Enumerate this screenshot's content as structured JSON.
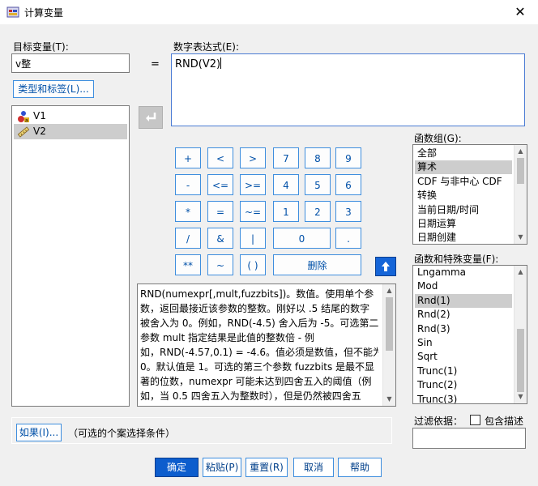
{
  "window": {
    "title": "计算变量",
    "close_glyph": "✕"
  },
  "target": {
    "label": "目标变量(T):",
    "value": "v整",
    "type_label_button": "类型和标签(L)..."
  },
  "equals": "=",
  "expression": {
    "label": "数字表达式(E):",
    "value": "RND(V2)"
  },
  "variables": [
    {
      "name": "V1",
      "icon": "nominal-variable-icon"
    },
    {
      "name": "V2",
      "icon": "scale-variable-icon",
      "selected": true
    }
  ],
  "keypad": {
    "rows": [
      [
        "+",
        "<",
        ">",
        "7",
        "8",
        "9"
      ],
      [
        "-",
        "<=",
        ">=",
        "4",
        "5",
        "6"
      ],
      [
        "*",
        "=",
        "~=",
        "1",
        "2",
        "3"
      ],
      [
        "/",
        "&",
        "|",
        "0",
        "."
      ],
      [
        "**",
        "~",
        "( )",
        "删除"
      ]
    ]
  },
  "function_group": {
    "label": "函数组(G):",
    "items": [
      "全部",
      "算术",
      "CDF 与非中心 CDF",
      "转换",
      "当前日期/时间",
      "日期运算",
      "日期创建"
    ],
    "selected_index": 1
  },
  "functions": {
    "label": "函数和特殊变量(F):",
    "items": [
      "Lngamma",
      "Mod",
      "Rnd(1)",
      "Rnd(2)",
      "Rnd(3)",
      "Sin",
      "Sqrt",
      "Trunc(1)",
      "Trunc(2)",
      "Trunc(3)"
    ],
    "selected_index": 2
  },
  "description": {
    "lines": [
      "RND(numexpr[,mult,fuzzbits])。数值。使用单个参",
      "数，返回最接近该参数的整数。刚好以 .5 结尾的数字",
      "被舍入为 0。例如，RND(-4.5) 舍入后为 -5。可选第二",
      "参数 mult 指定结果是此值的整数倍 - 例",
      "如，RND(-4.57,0.1) = -4.6。值必须是数值，但不能为",
      "0。默认值是 1。可选的第三个参数 fuzzbits 是最不显",
      "著的位数，numexpr 可能未达到四舍五入的阈值（例",
      "如，当 0.5 四舍五入为整数时），但是仍然被四舍五"
    ]
  },
  "filter": {
    "label": "过滤依据：",
    "include_desc_label": "包含描述"
  },
  "if_section": {
    "button": "如果(I)...",
    "text": "（可选的个案选择条件）"
  },
  "buttons": {
    "ok": "确定",
    "paste": "粘贴(P)",
    "reset": "重置(R)",
    "cancel": "取消",
    "help": "帮助"
  }
}
